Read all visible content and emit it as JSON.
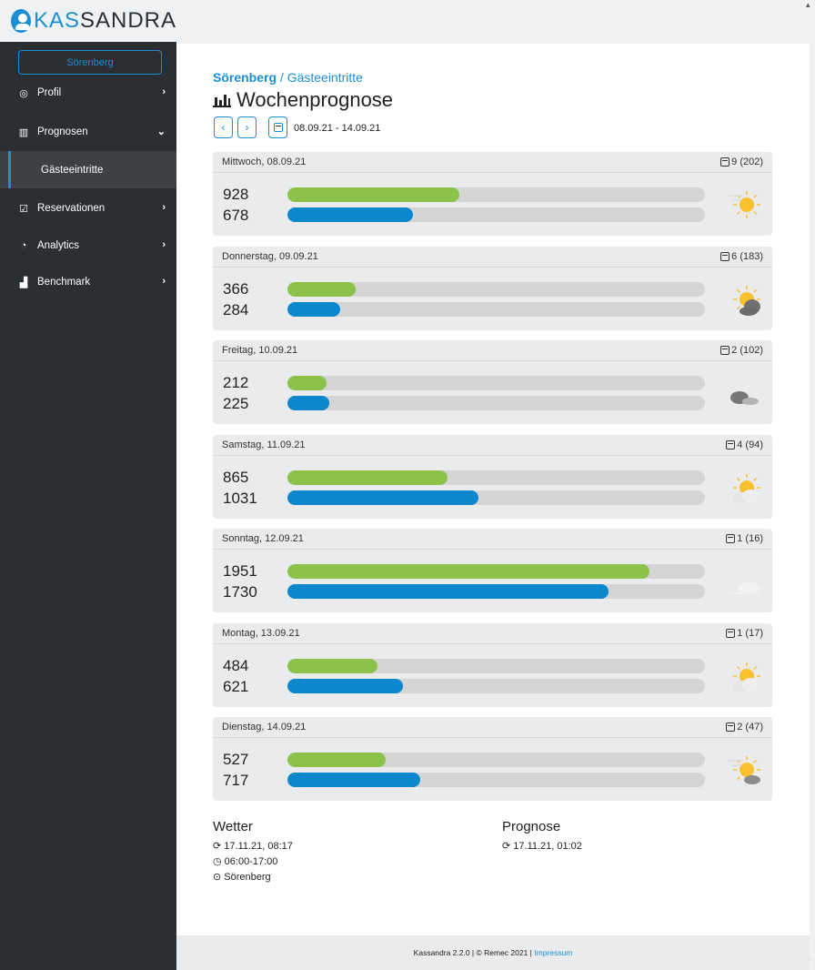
{
  "app": {
    "logo_part1": "KAS",
    "logo_part2": "SANDRA"
  },
  "sidebar": {
    "location_button": "Sörenberg",
    "items": [
      {
        "label": "Profil",
        "icon": "user-circle-icon"
      },
      {
        "label": "Prognosen",
        "icon": "bar-chart-icon"
      },
      {
        "label": "Gästeeintritte"
      },
      {
        "label": "Reservationen",
        "icon": "calendar-check-icon"
      },
      {
        "label": "Analytics",
        "icon": "pie-chart-icon"
      },
      {
        "label": "Benchmark",
        "icon": "benchmark-chart-icon"
      }
    ]
  },
  "breadcrumb": {
    "location": "Sörenberg",
    "separator": "/",
    "page": "Gästeeintritte"
  },
  "title": "Wochenprognose",
  "date_range": "08.09.21 - 14.09.21",
  "colors": {
    "accent": "#1b8fd1",
    "actual_bar": "#8bc34a",
    "forecast_bar": "#0a87cd",
    "sidebar": "#2b2f33"
  },
  "scale_max": 2250,
  "days": [
    {
      "date": "Mittwoch, 08.09.21",
      "reservations": "9 (202)",
      "value1": 928,
      "value2": 678,
      "weather": "sunny-windy"
    },
    {
      "date": "Donnerstag, 09.09.21",
      "reservations": "6 (183)",
      "value1": 366,
      "value2": 284,
      "weather": "sun-dark-cloud"
    },
    {
      "date": "Freitag, 10.09.21",
      "reservations": "2 (102)",
      "value1": 212,
      "value2": 225,
      "weather": "cloudy"
    },
    {
      "date": "Samstag, 11.09.21",
      "reservations": "4 (94)",
      "value1": 865,
      "value2": 1031,
      "weather": "partly-sunny"
    },
    {
      "date": "Sonntag, 12.09.21",
      "reservations": "1 (16)",
      "value1": 1951,
      "value2": 1730,
      "weather": "foggy-clouds"
    },
    {
      "date": "Montag, 13.09.21",
      "reservations": "1 (17)",
      "value1": 484,
      "value2": 621,
      "weather": "partly-sunny"
    },
    {
      "date": "Dienstag, 14.09.21",
      "reservations": "2 (47)",
      "value1": 527,
      "value2": 717,
      "weather": "sun-cloud"
    }
  ],
  "info": {
    "weather_title": "Wetter",
    "weather_updated": "17.11.21, 08:17",
    "weather_hours": "06:00-17:00",
    "weather_location": "Sörenberg",
    "forecast_title": "Prognose",
    "forecast_updated": "17.11.21, 01:02"
  },
  "footer": {
    "text": "Kassandra 2.2.0 | © Remec 2021 |",
    "link": "Impressum"
  }
}
